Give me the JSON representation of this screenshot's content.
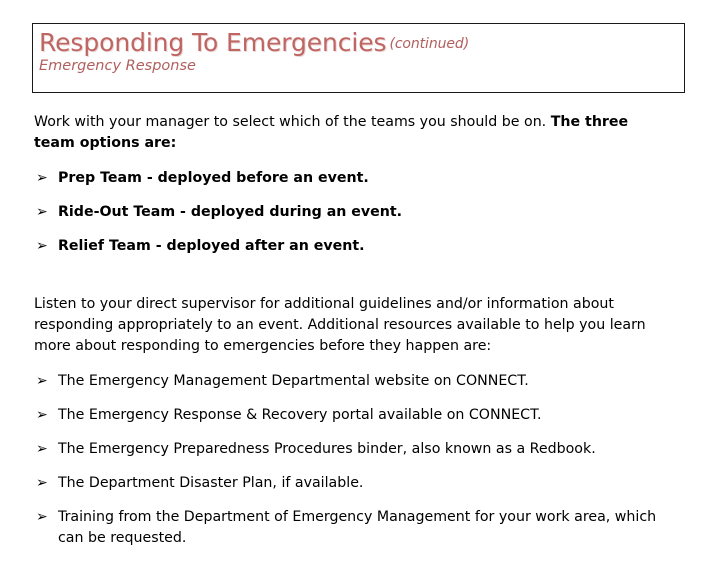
{
  "slide": {
    "background_color": "#ffffff",
    "accent_color": "#bf6663",
    "text_color": "#000000",
    "border_color": "#1a1a1a"
  },
  "header": {
    "title": "Responding To Emergencies",
    "title_suffix": "(continued)",
    "subtitle": "Emergency Response"
  },
  "body": {
    "intro_regular": "Work with your manager to select which of the teams you should be on. ",
    "intro_bold": "The three team options are:",
    "listen_paragraph": "Listen to your direct supervisor for additional guidelines and/or information about responding appropriately to an event.  Additional resources available to help you learn more about responding to emergencies before they happen are:"
  },
  "bullet_glyph": "➢",
  "team_options": [
    {
      "text": "Prep Team - deployed before an event."
    },
    {
      "text": "Ride-Out Team - deployed during an event."
    },
    {
      "text": "Relief Team - deployed after an event."
    }
  ],
  "resources": [
    {
      "text": "The Emergency Management Departmental website on CONNECT."
    },
    {
      "text": "The Emergency Response & Recovery portal available on CONNECT."
    },
    {
      "text": "The Emergency Preparedness Procedures binder, also known as a Redbook."
    },
    {
      "text": "The Department Disaster Plan, if available."
    },
    {
      "text": "Training from the Department of Emergency Management for your work area, which can be requested."
    }
  ]
}
